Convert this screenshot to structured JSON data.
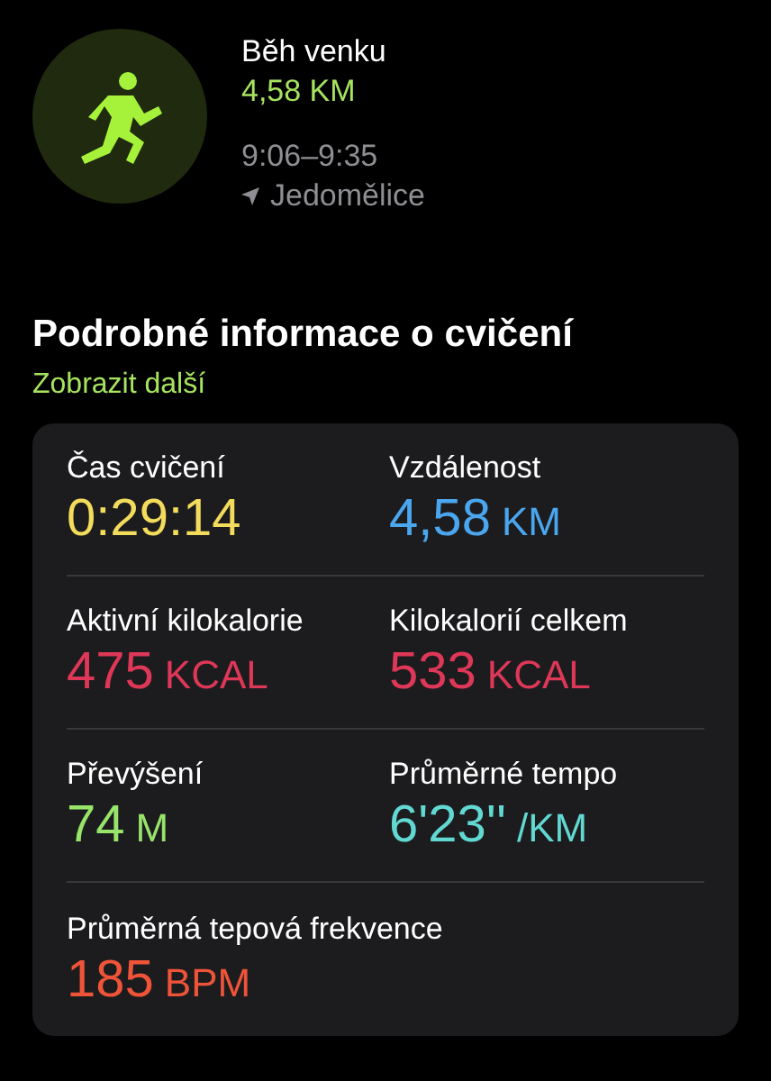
{
  "workout": {
    "title": "Běh venku",
    "distance": "4,58 KM",
    "time": "9:06–9:35",
    "location": "Jedomělice"
  },
  "details": {
    "title": "Podrobné informace o cvičení",
    "link": "Zobrazit další",
    "metrics": [
      {
        "label": "Čas cvičení",
        "value": "0:29:14",
        "color": "#f3dc5c"
      },
      {
        "label": "Vzdálenost",
        "value": "4,58",
        "unit": "KM",
        "color": "#4aa6ee"
      },
      {
        "label": "Aktivní kilokalorie",
        "value": "475",
        "unit": "KCAL",
        "color": "#de3757"
      },
      {
        "label": "Kilokalorií celkem",
        "value": "533",
        "unit": "KCAL",
        "color": "#de3757"
      },
      {
        "label": "Převýšení",
        "value": "74",
        "unit": "M",
        "color": "#98e46a"
      },
      {
        "label": "Průměrné tempo",
        "value": "6'23''",
        "unit": "/KM",
        "color": "#62d8d2"
      },
      {
        "label": "Průměrná tepová frekvence",
        "value": "185",
        "unit": "BPM",
        "color": "#ef5439"
      }
    ]
  }
}
